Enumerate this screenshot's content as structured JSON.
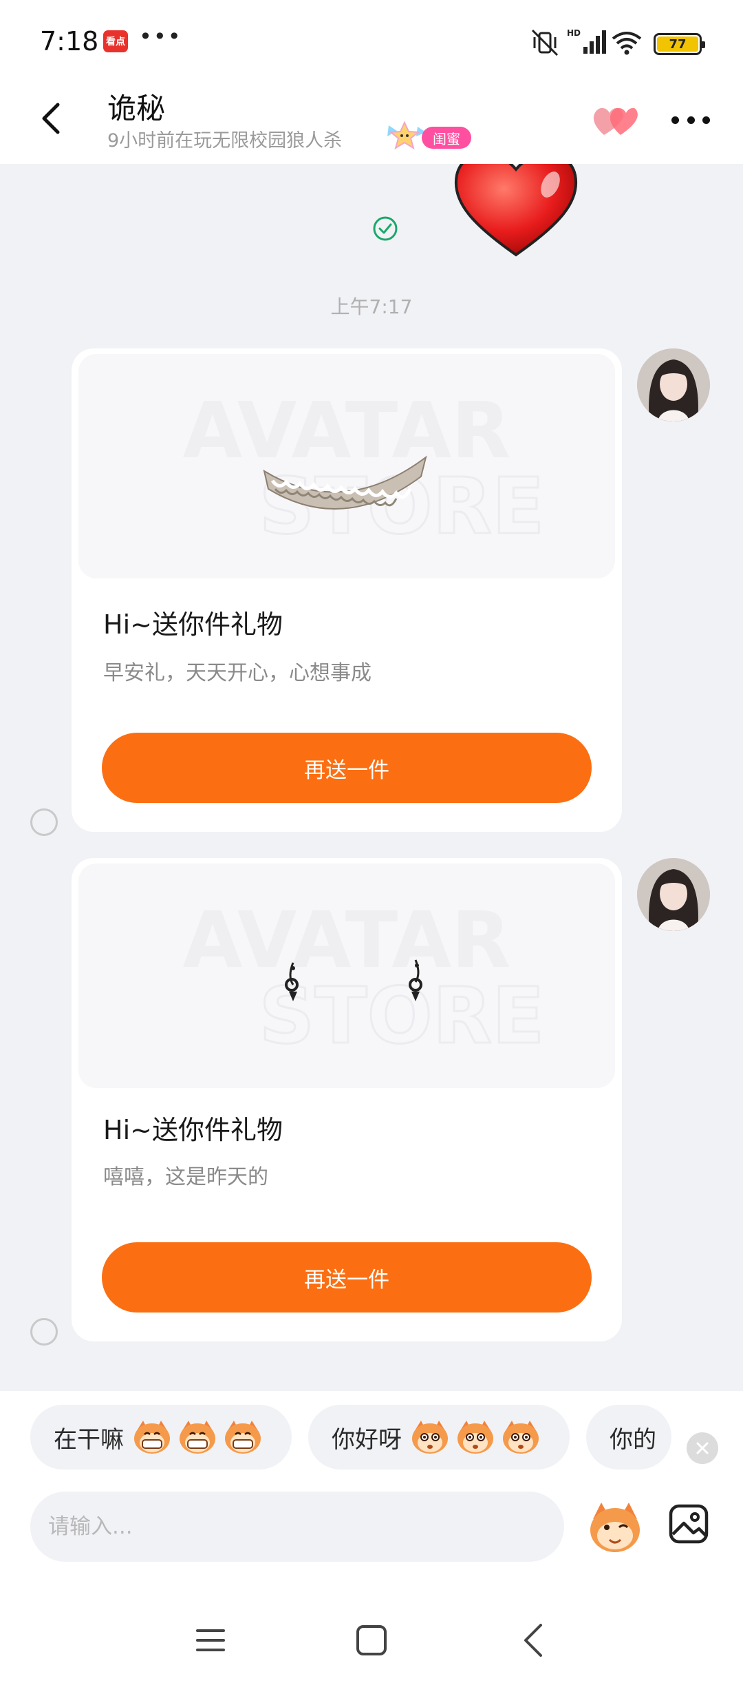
{
  "status_bar": {
    "time": "7:18",
    "app_badge": "看点",
    "more_dots": "•••",
    "battery_level": "77",
    "icons": [
      "mute-vibrate-icon",
      "hd-signal-icon",
      "wifi-icon",
      "battery-icon"
    ]
  },
  "header": {
    "title": "诡秘",
    "subtitle": "9小时前在玩无限校园狼人杀",
    "friend_tag": "闺蜜",
    "accent_color": "#ff4fa0",
    "icons": [
      "back-icon",
      "double-heart-icon",
      "more-icon"
    ]
  },
  "chat": {
    "timestamp": "上午7:17",
    "messages": [
      {
        "type": "gift-card",
        "title": "Hi~送你件礼物",
        "message": "早安礼，天天开心，心想事成",
        "button_label": "再送一件",
        "gift_icon": "lace-choker-gift"
      },
      {
        "type": "gift-card",
        "title": "Hi~送你件礼物",
        "message": "嘻嘻，这是昨天的",
        "button_label": "再送一件",
        "gift_icon": "drop-earrings-gift"
      }
    ],
    "button_color": "#fb6f12"
  },
  "quick_replies": [
    {
      "text": "在干嘛",
      "emoji": "grinning-monkey-icon"
    },
    {
      "text": "你好呀",
      "emoji": "curious-monkey-icon"
    },
    {
      "text": "你的"
    }
  ],
  "input": {
    "placeholder": "请输入..."
  },
  "nav": {
    "icons": [
      "menu-icon",
      "home-icon",
      "back-icon"
    ]
  }
}
